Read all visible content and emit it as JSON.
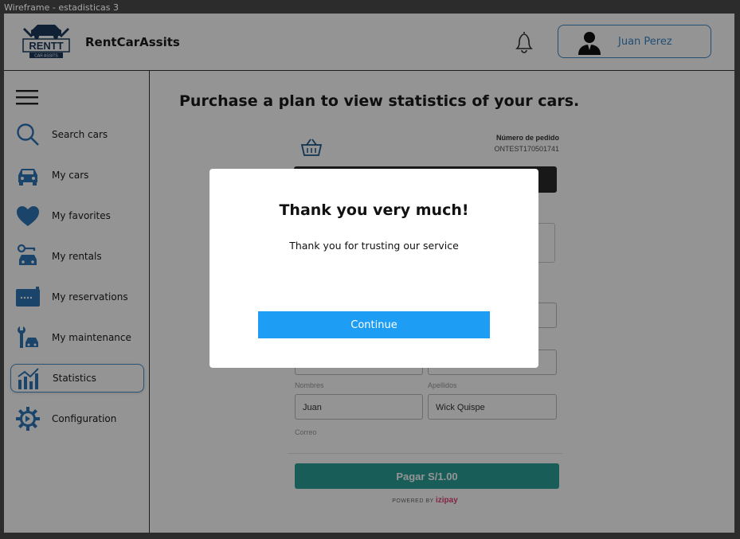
{
  "window": {
    "title": "Wireframe - estadisticas 3"
  },
  "header": {
    "logo_text": "RENTT",
    "logo_subtext": "CAR ASSITS",
    "brand": "RentCarAssits",
    "user_name": "Juan Perez"
  },
  "sidebar": {
    "items": [
      {
        "label": "Search cars",
        "icon": "search-icon"
      },
      {
        "label": "My cars",
        "icon": "car-icon"
      },
      {
        "label": "My favorites",
        "icon": "heart-icon"
      },
      {
        "label": "My rentals",
        "icon": "key-car-icon"
      },
      {
        "label": "My reservations",
        "icon": "calendar-icon"
      },
      {
        "label": "My maintenance",
        "icon": "wrench-car-icon"
      },
      {
        "label": "Statistics",
        "icon": "bar-chart-icon",
        "active": true
      },
      {
        "label": "Configuration",
        "icon": "gear-icon"
      }
    ]
  },
  "main": {
    "title": "Purchase a plan to view statistics of your cars."
  },
  "checkout": {
    "order_label": "Número de pedido",
    "order_number": "ONTEST170501741",
    "name_label": "Nombres",
    "name_value": "Juan",
    "surname_label": "Apellidos",
    "surname_value": "Wick Quispe",
    "email_label": "Correo",
    "pay_label": "Pagar S/1.00",
    "powered_by": "POWERED BY",
    "powered_brand": "izipay"
  },
  "modal": {
    "title": "Thank you very much!",
    "message": "Thank you for trusting our service",
    "continue_label": "Continue"
  },
  "colors": {
    "accent": "#3a88c8",
    "button": "#1e9df5",
    "pay": "#2aa198",
    "icon": "#2f76b8"
  }
}
